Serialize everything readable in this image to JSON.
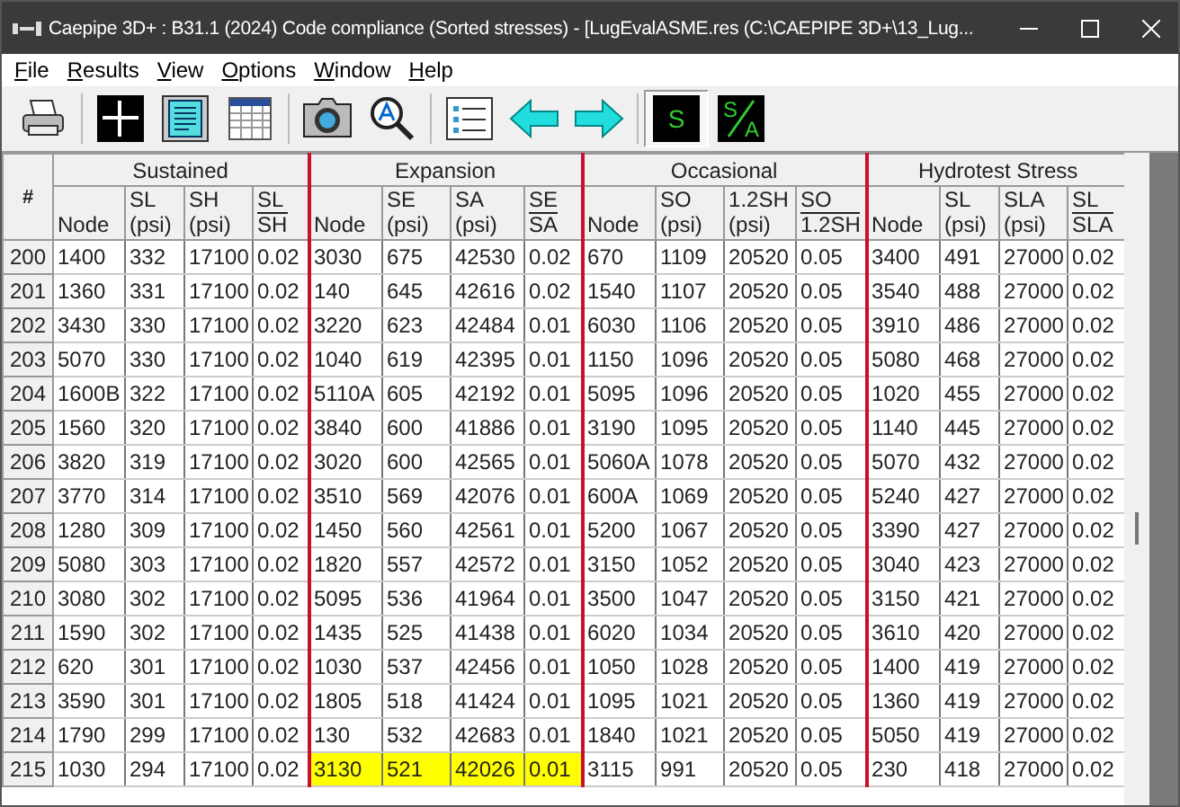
{
  "window": {
    "title": "Caepipe 3D+ : B31.1 (2024) Code compliance (Sorted stresses) -  [LugEvalASME.res (C:\\CAEPIPE 3D+\\13_Lug..."
  },
  "menu": [
    {
      "label": "File"
    },
    {
      "label": "Results"
    },
    {
      "label": "View"
    },
    {
      "label": "Options"
    },
    {
      "label": "Window"
    },
    {
      "label": "Help"
    }
  ],
  "toolbar": {
    "s_button": {
      "label": "S",
      "pressed": true
    },
    "sa_button": {
      "top": "S",
      "bottom": "A",
      "pressed": false
    }
  },
  "table": {
    "index_header": "#",
    "groups": [
      {
        "title": "Sustained",
        "columns": [
          {
            "label": "Node"
          },
          {
            "top": "SL",
            "bottom": "(psi)"
          },
          {
            "top": "SH",
            "bottom": "(psi)"
          },
          {
            "num": "SL",
            "den": "SH"
          }
        ]
      },
      {
        "title": "Expansion",
        "columns": [
          {
            "label": "Node"
          },
          {
            "top": "SE",
            "bottom": "(psi)"
          },
          {
            "top": "SA",
            "bottom": "(psi)"
          },
          {
            "num": "SE",
            "den": "SA"
          }
        ]
      },
      {
        "title": "Occasional",
        "columns": [
          {
            "label": "Node"
          },
          {
            "top": "SO",
            "bottom": "(psi)"
          },
          {
            "top": "1.2SH",
            "bottom": "(psi)"
          },
          {
            "num": "SO",
            "den": "1.2SH"
          }
        ]
      },
      {
        "title": "Hydrotest Stress",
        "columns": [
          {
            "label": "Node"
          },
          {
            "top": "SL",
            "bottom": "(psi)"
          },
          {
            "top": "SLA",
            "bottom": "(psi)"
          },
          {
            "num": "SL",
            "den": "SLA"
          }
        ]
      }
    ],
    "rows": [
      {
        "index": "200",
        "groups": [
          {
            "cells": [
              "1400",
              "332",
              "17100",
              "0.02"
            ],
            "highlighted": false
          },
          {
            "cells": [
              "3030",
              "675",
              "42530",
              "0.02"
            ],
            "highlighted": false
          },
          {
            "cells": [
              "670",
              "1109",
              "20520",
              "0.05"
            ],
            "highlighted": false
          },
          {
            "cells": [
              "3400",
              "491",
              "27000",
              "0.02"
            ],
            "highlighted": false
          }
        ]
      },
      {
        "index": "201",
        "groups": [
          {
            "cells": [
              "1360",
              "331",
              "17100",
              "0.02"
            ],
            "highlighted": false
          },
          {
            "cells": [
              "140",
              "645",
              "42616",
              "0.02"
            ],
            "highlighted": false
          },
          {
            "cells": [
              "1540",
              "1107",
              "20520",
              "0.05"
            ],
            "highlighted": false
          },
          {
            "cells": [
              "3540",
              "488",
              "27000",
              "0.02"
            ],
            "highlighted": false
          }
        ]
      },
      {
        "index": "202",
        "groups": [
          {
            "cells": [
              "3430",
              "330",
              "17100",
              "0.02"
            ],
            "highlighted": false
          },
          {
            "cells": [
              "3220",
              "623",
              "42484",
              "0.01"
            ],
            "highlighted": false
          },
          {
            "cells": [
              "6030",
              "1106",
              "20520",
              "0.05"
            ],
            "highlighted": false
          },
          {
            "cells": [
              "3910",
              "486",
              "27000",
              "0.02"
            ],
            "highlighted": false
          }
        ]
      },
      {
        "index": "203",
        "groups": [
          {
            "cells": [
              "5070",
              "330",
              "17100",
              "0.02"
            ],
            "highlighted": false
          },
          {
            "cells": [
              "1040",
              "619",
              "42395",
              "0.01"
            ],
            "highlighted": false
          },
          {
            "cells": [
              "1150",
              "1096",
              "20520",
              "0.05"
            ],
            "highlighted": false
          },
          {
            "cells": [
              "5080",
              "468",
              "27000",
              "0.02"
            ],
            "highlighted": false
          }
        ]
      },
      {
        "index": "204",
        "groups": [
          {
            "cells": [
              "1600B",
              "322",
              "17100",
              "0.02"
            ],
            "highlighted": false
          },
          {
            "cells": [
              "5110A",
              "605",
              "42192",
              "0.01"
            ],
            "highlighted": false
          },
          {
            "cells": [
              "5095",
              "1096",
              "20520",
              "0.05"
            ],
            "highlighted": false
          },
          {
            "cells": [
              "1020",
              "455",
              "27000",
              "0.02"
            ],
            "highlighted": false
          }
        ]
      },
      {
        "index": "205",
        "groups": [
          {
            "cells": [
              "1560",
              "320",
              "17100",
              "0.02"
            ],
            "highlighted": false
          },
          {
            "cells": [
              "3840",
              "600",
              "41886",
              "0.01"
            ],
            "highlighted": false
          },
          {
            "cells": [
              "3190",
              "1095",
              "20520",
              "0.05"
            ],
            "highlighted": false
          },
          {
            "cells": [
              "1140",
              "445",
              "27000",
              "0.02"
            ],
            "highlighted": false
          }
        ]
      },
      {
        "index": "206",
        "groups": [
          {
            "cells": [
              "3820",
              "319",
              "17100",
              "0.02"
            ],
            "highlighted": false
          },
          {
            "cells": [
              "3020",
              "600",
              "42565",
              "0.01"
            ],
            "highlighted": false
          },
          {
            "cells": [
              "5060A",
              "1078",
              "20520",
              "0.05"
            ],
            "highlighted": false
          },
          {
            "cells": [
              "5070",
              "432",
              "27000",
              "0.02"
            ],
            "highlighted": false
          }
        ]
      },
      {
        "index": "207",
        "groups": [
          {
            "cells": [
              "3770",
              "314",
              "17100",
              "0.02"
            ],
            "highlighted": false
          },
          {
            "cells": [
              "3510",
              "569",
              "42076",
              "0.01"
            ],
            "highlighted": false
          },
          {
            "cells": [
              "600A",
              "1069",
              "20520",
              "0.05"
            ],
            "highlighted": false
          },
          {
            "cells": [
              "5240",
              "427",
              "27000",
              "0.02"
            ],
            "highlighted": false
          }
        ]
      },
      {
        "index": "208",
        "groups": [
          {
            "cells": [
              "1280",
              "309",
              "17100",
              "0.02"
            ],
            "highlighted": false
          },
          {
            "cells": [
              "1450",
              "560",
              "42561",
              "0.01"
            ],
            "highlighted": false
          },
          {
            "cells": [
              "5200",
              "1067",
              "20520",
              "0.05"
            ],
            "highlighted": false
          },
          {
            "cells": [
              "3390",
              "427",
              "27000",
              "0.02"
            ],
            "highlighted": false
          }
        ]
      },
      {
        "index": "209",
        "groups": [
          {
            "cells": [
              "5080",
              "303",
              "17100",
              "0.02"
            ],
            "highlighted": false
          },
          {
            "cells": [
              "1820",
              "557",
              "42572",
              "0.01"
            ],
            "highlighted": false
          },
          {
            "cells": [
              "3150",
              "1052",
              "20520",
              "0.05"
            ],
            "highlighted": false
          },
          {
            "cells": [
              "3040",
              "423",
              "27000",
              "0.02"
            ],
            "highlighted": false
          }
        ]
      },
      {
        "index": "210",
        "groups": [
          {
            "cells": [
              "3080",
              "302",
              "17100",
              "0.02"
            ],
            "highlighted": false
          },
          {
            "cells": [
              "5095",
              "536",
              "41964",
              "0.01"
            ],
            "highlighted": false
          },
          {
            "cells": [
              "3500",
              "1047",
              "20520",
              "0.05"
            ],
            "highlighted": false
          },
          {
            "cells": [
              "3150",
              "421",
              "27000",
              "0.02"
            ],
            "highlighted": false
          }
        ]
      },
      {
        "index": "211",
        "groups": [
          {
            "cells": [
              "1590",
              "302",
              "17100",
              "0.02"
            ],
            "highlighted": false
          },
          {
            "cells": [
              "1435",
              "525",
              "41438",
              "0.01"
            ],
            "highlighted": false
          },
          {
            "cells": [
              "6020",
              "1034",
              "20520",
              "0.05"
            ],
            "highlighted": false
          },
          {
            "cells": [
              "3610",
              "420",
              "27000",
              "0.02"
            ],
            "highlighted": false
          }
        ]
      },
      {
        "index": "212",
        "groups": [
          {
            "cells": [
              "620",
              "301",
              "17100",
              "0.02"
            ],
            "highlighted": false
          },
          {
            "cells": [
              "1030",
              "537",
              "42456",
              "0.01"
            ],
            "highlighted": false
          },
          {
            "cells": [
              "1050",
              "1028",
              "20520",
              "0.05"
            ],
            "highlighted": false
          },
          {
            "cells": [
              "1400",
              "419",
              "27000",
              "0.02"
            ],
            "highlighted": false
          }
        ]
      },
      {
        "index": "213",
        "groups": [
          {
            "cells": [
              "3590",
              "301",
              "17100",
              "0.02"
            ],
            "highlighted": false
          },
          {
            "cells": [
              "1805",
              "518",
              "41424",
              "0.01"
            ],
            "highlighted": false
          },
          {
            "cells": [
              "1095",
              "1021",
              "20520",
              "0.05"
            ],
            "highlighted": false
          },
          {
            "cells": [
              "1360",
              "419",
              "27000",
              "0.02"
            ],
            "highlighted": false
          }
        ]
      },
      {
        "index": "214",
        "groups": [
          {
            "cells": [
              "1790",
              "299",
              "17100",
              "0.02"
            ],
            "highlighted": false
          },
          {
            "cells": [
              "130",
              "532",
              "42683",
              "0.01"
            ],
            "highlighted": false
          },
          {
            "cells": [
              "1840",
              "1021",
              "20520",
              "0.05"
            ],
            "highlighted": false
          },
          {
            "cells": [
              "5050",
              "419",
              "27000",
              "0.02"
            ],
            "highlighted": false
          }
        ]
      },
      {
        "index": "215",
        "groups": [
          {
            "cells": [
              "1030",
              "294",
              "17100",
              "0.02"
            ],
            "highlighted": false
          },
          {
            "cells": [
              "3130",
              "521",
              "42026",
              "0.01"
            ],
            "highlighted": true
          },
          {
            "cells": [
              "3115",
              "991",
              "20520",
              "0.05"
            ],
            "highlighted": false
          },
          {
            "cells": [
              "230",
              "418",
              "27000",
              "0.02"
            ],
            "highlighted": false
          }
        ]
      }
    ]
  }
}
